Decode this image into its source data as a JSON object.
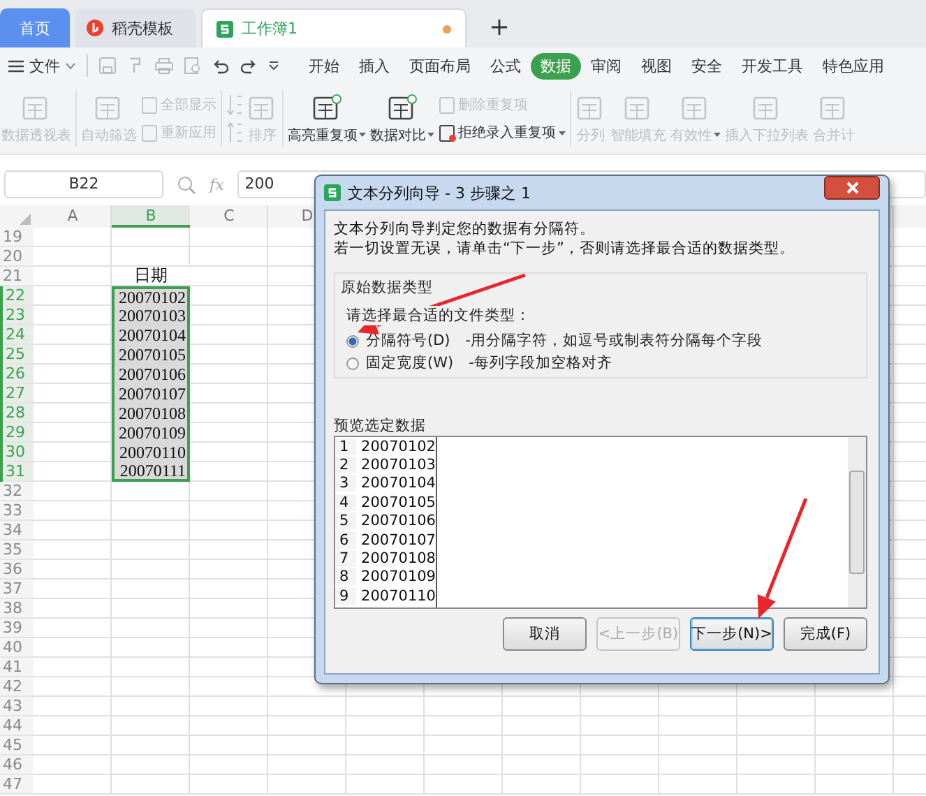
{
  "tabs": [
    {
      "label": "首页",
      "kind": "home",
      "selected": false
    },
    {
      "label": "稻壳模板",
      "kind": "docer",
      "selected": false
    },
    {
      "label": "工作簿1",
      "kind": "sheet",
      "selected": true,
      "unsaved": true
    }
  ],
  "menu": {
    "file": "文件",
    "tabs": [
      {
        "label": "开始",
        "selected": false
      },
      {
        "label": "插入",
        "selected": false
      },
      {
        "label": "页面布局",
        "selected": false
      },
      {
        "label": "公式",
        "selected": false
      },
      {
        "label": "数据",
        "selected": true
      },
      {
        "label": "审阅",
        "selected": false
      },
      {
        "label": "视图",
        "selected": false
      },
      {
        "label": "安全",
        "selected": false
      },
      {
        "label": "开发工具",
        "selected": false
      },
      {
        "label": "特色应用",
        "selected": false
      }
    ]
  },
  "ribbon": [
    {
      "columns": [
        {
          "kind": "large",
          "label": "数据透视表",
          "disabled": true,
          "dropdown": false
        }
      ]
    },
    {
      "columns": [
        {
          "kind": "large",
          "label": "自动筛选",
          "disabled": true,
          "dropdown": false
        },
        {
          "kind": "stack",
          "items": [
            {
              "label": "全部显示",
              "disabled": true,
              "dropdown": false
            },
            {
              "label": "重新应用",
              "disabled": true,
              "dropdown": false
            }
          ]
        }
      ]
    },
    {
      "columns": [
        {
          "kind": "sort",
          "disabled": true
        },
        {
          "kind": "large",
          "label": "排序",
          "disabled": true,
          "dropdown": false
        }
      ]
    },
    {
      "columns": [
        {
          "kind": "large",
          "label": "高亮重复项",
          "disabled": false,
          "dropdown": true
        },
        {
          "kind": "large",
          "label": "数据对比",
          "disabled": false,
          "dropdown": true
        },
        {
          "kind": "stack",
          "items": [
            {
              "label": "删除重复项",
              "disabled": true,
              "dropdown": false
            },
            {
              "label": "拒绝录入重复项",
              "disabled": false,
              "dropdown": true
            }
          ]
        }
      ]
    },
    {
      "columns": [
        {
          "kind": "large",
          "label": "分列",
          "disabled": true,
          "dropdown": false
        },
        {
          "kind": "large",
          "label": "智能填充",
          "disabled": true,
          "dropdown": false
        },
        {
          "kind": "large",
          "label": "有效性",
          "disabled": true,
          "dropdown": true
        },
        {
          "kind": "large",
          "label": "插入下拉列表",
          "disabled": true,
          "dropdown": false
        },
        {
          "kind": "large",
          "label": "合并计",
          "disabled": true,
          "dropdown": false
        }
      ]
    }
  ],
  "formula_bar": {
    "name_box": "B22",
    "fx_label": "fx",
    "value": "200"
  },
  "sheet": {
    "columns": [
      {
        "label": "A",
        "selected": false
      },
      {
        "label": "B",
        "selected": true
      },
      {
        "label": "C",
        "selected": false
      },
      {
        "label": "D",
        "selected": false
      }
    ],
    "rows": [
      {
        "num": "19",
        "selected": false
      },
      {
        "num": "20",
        "selected": false
      },
      {
        "num": "21",
        "selected": false,
        "B": "日期"
      },
      {
        "num": "22",
        "selected": true,
        "B": "20070102"
      },
      {
        "num": "23",
        "selected": true,
        "B": "20070103"
      },
      {
        "num": "24",
        "selected": true,
        "B": "20070104"
      },
      {
        "num": "25",
        "selected": true,
        "B": "20070105"
      },
      {
        "num": "26",
        "selected": true,
        "B": "20070106"
      },
      {
        "num": "27",
        "selected": true,
        "B": "20070107"
      },
      {
        "num": "28",
        "selected": true,
        "B": "20070108"
      },
      {
        "num": "29",
        "selected": true,
        "B": "20070109"
      },
      {
        "num": "30",
        "selected": true,
        "B": "20070110"
      },
      {
        "num": "31",
        "selected": true,
        "B": "20070111"
      },
      {
        "num": "32",
        "selected": false
      },
      {
        "num": "33",
        "selected": false
      },
      {
        "num": "34",
        "selected": false
      },
      {
        "num": "35",
        "selected": false
      },
      {
        "num": "36",
        "selected": false
      },
      {
        "num": "37",
        "selected": false
      },
      {
        "num": "38",
        "selected": false
      },
      {
        "num": "39",
        "selected": false
      },
      {
        "num": "40",
        "selected": false
      },
      {
        "num": "41",
        "selected": false
      },
      {
        "num": "42",
        "selected": false
      },
      {
        "num": "43",
        "selected": false
      },
      {
        "num": "44",
        "selected": false
      },
      {
        "num": "45",
        "selected": false
      },
      {
        "num": "46",
        "selected": false
      },
      {
        "num": "47",
        "selected": false
      }
    ]
  },
  "dialog": {
    "title": "文本分列向导 - 3 步骤之 1",
    "intro": [
      "文本分列向导判定您的数据有分隔符。",
      "若一切设置无误，请单击“下一步”，否则请选择最合适的数据类型。"
    ],
    "group_title": "原始数据类型",
    "prompt": "请选择最合适的文件类型：",
    "options": [
      {
        "label": "分隔符号(D)",
        "desc": "-用分隔字符，如逗号或制表符分隔每个字段",
        "selected": true
      },
      {
        "label": "固定宽度(W)",
        "desc": "-每列字段加空格对齐",
        "selected": false
      }
    ],
    "preview_label": "预览选定数据",
    "preview": [
      {
        "num": "1",
        "value": "20070102"
      },
      {
        "num": "2",
        "value": "20070103"
      },
      {
        "num": "3",
        "value": "20070104"
      },
      {
        "num": "4",
        "value": "20070105"
      },
      {
        "num": "5",
        "value": "20070106"
      },
      {
        "num": "6",
        "value": "20070107"
      },
      {
        "num": "7",
        "value": "20070108"
      },
      {
        "num": "8",
        "value": "20070109"
      },
      {
        "num": "9",
        "value": "20070110"
      }
    ],
    "buttons": [
      {
        "label": "取消",
        "disabled": false,
        "focused": false
      },
      {
        "label": "<上一步(B)",
        "disabled": true,
        "focused": false
      },
      {
        "label": "下一步(N)>",
        "disabled": false,
        "focused": true
      },
      {
        "label": "完成(F)",
        "disabled": false,
        "focused": false
      }
    ]
  }
}
